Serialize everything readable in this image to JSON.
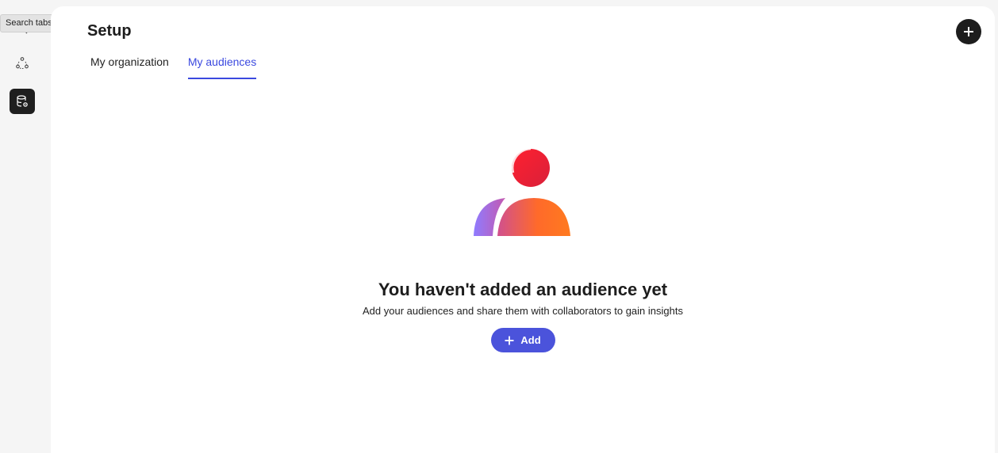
{
  "tooltip": "Search tabs",
  "rail": {
    "items": [
      {
        "icon": "search-tabs-icon",
        "active": false
      },
      {
        "icon": "people-network-icon",
        "active": false
      },
      {
        "icon": "database-settings-icon",
        "active": true
      }
    ]
  },
  "page": {
    "title": "Setup",
    "tabs": [
      {
        "label": "My organization",
        "active": false
      },
      {
        "label": "My audiences",
        "active": true
      }
    ],
    "add_icon": "plus-icon"
  },
  "empty_state": {
    "illustration": "audience-people-icon",
    "title": "You haven't added an audience yet",
    "description": "Add your audiences and share them with collaborators to gain insights",
    "button_label": "Add"
  },
  "colors": {
    "accent": "#3b49df",
    "button": "#4b53db",
    "dark": "#1d1d1d"
  }
}
